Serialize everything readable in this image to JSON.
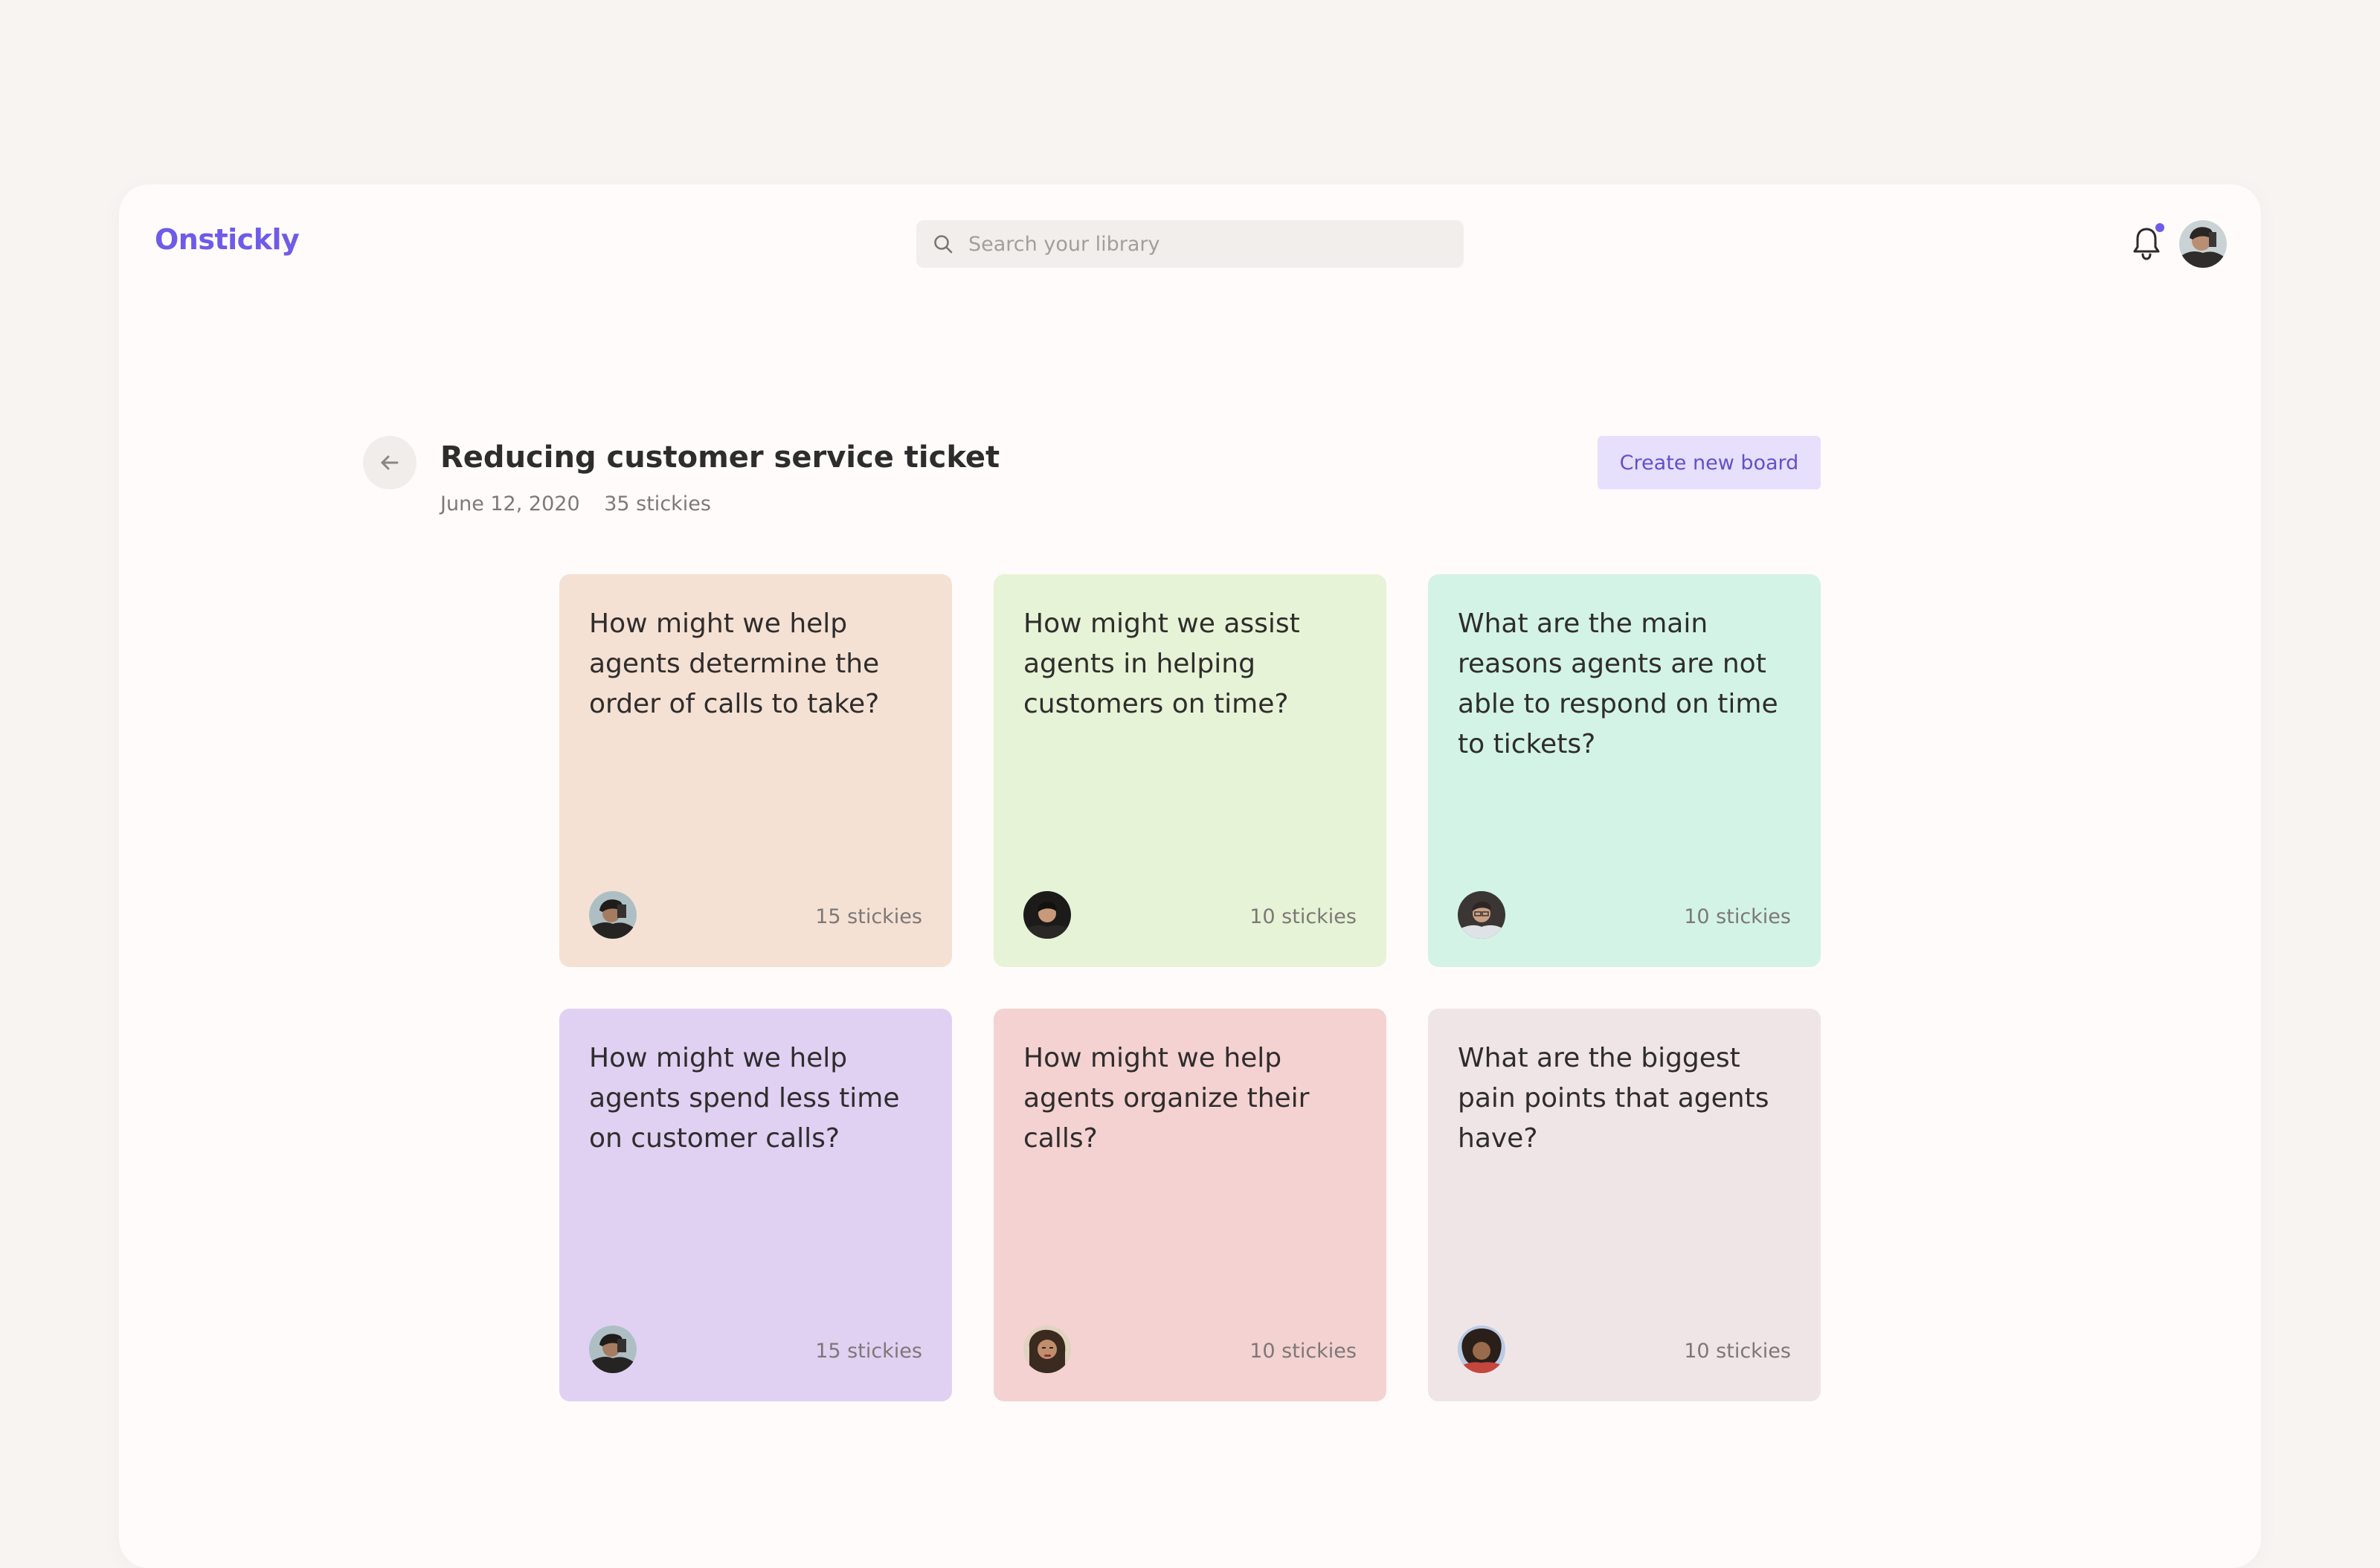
{
  "app": {
    "name": "Onstickly"
  },
  "search": {
    "placeholder": "Search your library"
  },
  "colors": {
    "brand": "#6e5be8",
    "notification_dot": "#6e5be8"
  },
  "icons": {
    "search": "search-icon",
    "notifications": "bell-icon",
    "back": "arrow-left-icon"
  },
  "board": {
    "title": "Reducing customer service ticket",
    "date": "June 12, 2020",
    "stickies": "35 stickies",
    "create_label": "Create new board"
  },
  "cards": [
    {
      "question": "How might we help agents determine the order of calls to take?",
      "count": "15 stickies",
      "color": "#f5e1d4"
    },
    {
      "question": "How might we assist agents in helping customers on time?",
      "count": "10 stickies",
      "color": "#e6f3d6"
    },
    {
      "question": "What are the main reasons agents are not able to respond on time to tickets?",
      "count": "10 stickies",
      "color": "#d3f3e7"
    },
    {
      "question": "How might we help agents spend less time on customer calls?",
      "count": "15 stickies",
      "color": "#e0d1f3"
    },
    {
      "question": "How might we help agents organize their calls?",
      "count": "10 stickies",
      "color": "#f3d2d1"
    },
    {
      "question": "What are the biggest pain points that agents have?",
      "count": "10 stickies",
      "color": "#efe5e6"
    }
  ]
}
